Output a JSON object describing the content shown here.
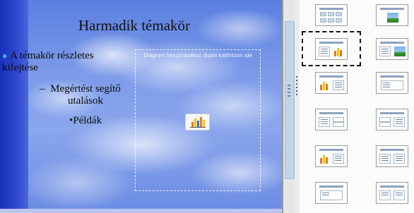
{
  "slide": {
    "title": "Harmadik témakör",
    "outline": {
      "level1": "A témakör részletes kifejtése",
      "level2_dash": "–",
      "level2": "Megértést segítő utalások",
      "level3_bullet": "•",
      "level3": "Példák"
    },
    "placeholder": {
      "hint": "Diagram beszúrásához dupla kattintson ide",
      "icon": "insert-chart-icon"
    }
  },
  "layouts_panel": {
    "selected_index": 2,
    "items": [
      {
        "name": "layout-title-table",
        "kind": "table"
      },
      {
        "name": "layout-title-picture",
        "kind": "picture"
      },
      {
        "name": "layout-title-content-chart",
        "kind": "content-chart"
      },
      {
        "name": "layout-title-content-picture",
        "kind": "content-picture"
      },
      {
        "name": "layout-title-chart-content",
        "kind": "chart-content"
      },
      {
        "name": "layout-title-content",
        "kind": "content"
      },
      {
        "name": "layout-title-2-content-stack",
        "kind": "content-split"
      },
      {
        "name": "layout-title-content-2-stack",
        "kind": "content-split-right"
      },
      {
        "name": "layout-title-chart-content-b",
        "kind": "chart-content"
      },
      {
        "name": "layout-title-content-b",
        "kind": "content"
      },
      {
        "name": "layout-title-only",
        "kind": "title-only"
      },
      {
        "name": "layout-title-2-content",
        "kind": "two-content"
      }
    ]
  },
  "colors": {
    "slide_sky": "#7d9be9",
    "slide_band": "#1b2fb8",
    "bullet": "#3fb0ff",
    "layout_bar": "#8da3bf",
    "chart_orange": "#e8771a",
    "chart_yellow": "#f3c21a",
    "chart_blue": "#3a6fc4"
  }
}
